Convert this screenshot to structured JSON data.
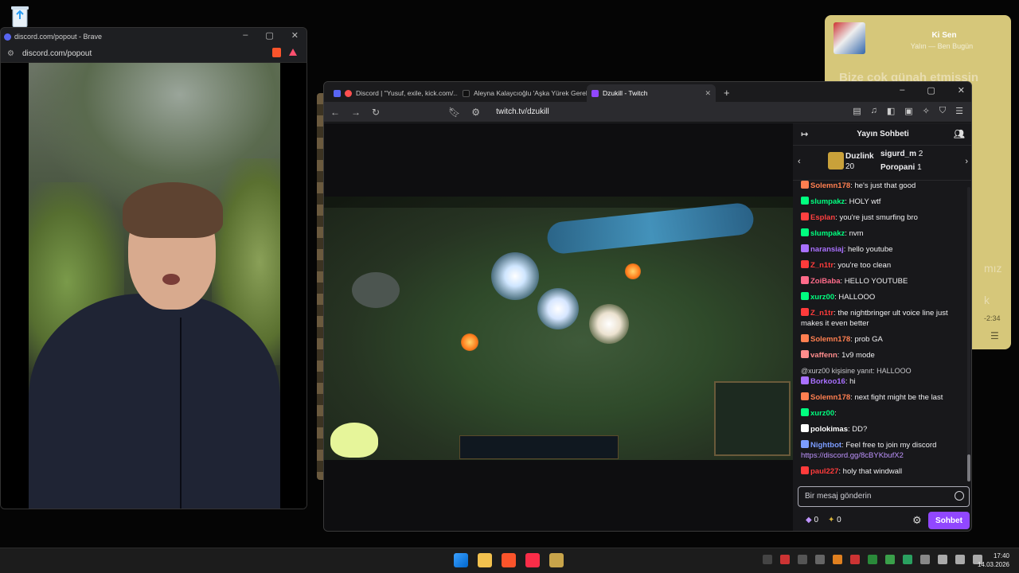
{
  "music": {
    "title": "Ki Sen",
    "artist": "Yalın — Ben Bugün",
    "lyric_line": "Bize çok günah etmissin",
    "lyric_fragment_1": "mız",
    "lyric_fragment_2": "k",
    "time": "-2:34"
  },
  "discord_window": {
    "title": "discord.com/popout - Brave",
    "url": "discord.com/popout"
  },
  "browser": {
    "tabs": [
      {
        "label": "Discord | \"Yusuf, exile, kick.com/..."
      },
      {
        "label": "Aleyna Kalaycıoğlu 'Aşka Yürek Gerek'..."
      },
      {
        "label": "Dzukill - Twitch"
      }
    ],
    "url": "twitch.tv/dzukill"
  },
  "chat": {
    "header": "Yayın Sohbeti",
    "gifters": [
      {
        "name": "Duzlink",
        "count": "20"
      },
      {
        "name": "sigurd_m",
        "count": "2"
      },
      {
        "name": "Poropani",
        "count": "1"
      }
    ],
    "messages": [
      {
        "user": "Solemn178",
        "color": "#ff7f50",
        "text": "he's just that good"
      },
      {
        "user": "slumpakz",
        "color": "#00ff7f",
        "text": "HOLY wtf"
      },
      {
        "user": "Esplan",
        "color": "#ff4040",
        "text": "you're just smurfing bro"
      },
      {
        "user": "slumpakz",
        "color": "#00ff7f",
        "text": "nvm"
      },
      {
        "user": "naransiaj",
        "color": "#a970ff",
        "text": "hello youtube"
      },
      {
        "user": "Z_n1tr",
        "color": "#ff3b3b",
        "text": "you're too clean"
      },
      {
        "user": "ZoiBaba",
        "color": "#ff6b8a",
        "text": "HELLO YOUTUBE"
      },
      {
        "user": "xurz00",
        "color": "#00ff7f",
        "text": "HALLOOO"
      },
      {
        "user": "Z_n1tr",
        "color": "#ff3b3b",
        "text": "the nightbringer ult voice line just makes it even better"
      },
      {
        "user": "Solemn178",
        "color": "#ff7f50",
        "text": "prob GA"
      },
      {
        "user": "vaffenn",
        "color": "#ff8c8c",
        "text": "1v9 mode"
      },
      {
        "reply": "@xurz00 kişisine yanıt: HALLOOO",
        "user": "Borkoo16",
        "color": "#a970ff",
        "text": "hi"
      },
      {
        "user": "Solemn178",
        "color": "#ff7f50",
        "text": "next fight might be the last"
      },
      {
        "user": "xurz00",
        "color": "#00ff7f",
        "text": ""
      },
      {
        "user": "polokimas",
        "color": "#ffffff",
        "text": "DD?"
      },
      {
        "user": "Nightbot",
        "color": "#7b9cff",
        "text": "Feel free to join my discord",
        "link": "https://discord.gg/8cBYKbufX2"
      },
      {
        "user": "paul227",
        "color": "#ff3b3b",
        "text": "holy that windwall"
      }
    ],
    "input_placeholder": "Bir mesaj gönderin",
    "points_1": "0",
    "points_2": "0",
    "send_label": "Sohbet",
    "colors": {
      "accent": "#9147ff"
    }
  },
  "taskbar": {
    "time": "17:40",
    "date": "14.03.2026"
  }
}
